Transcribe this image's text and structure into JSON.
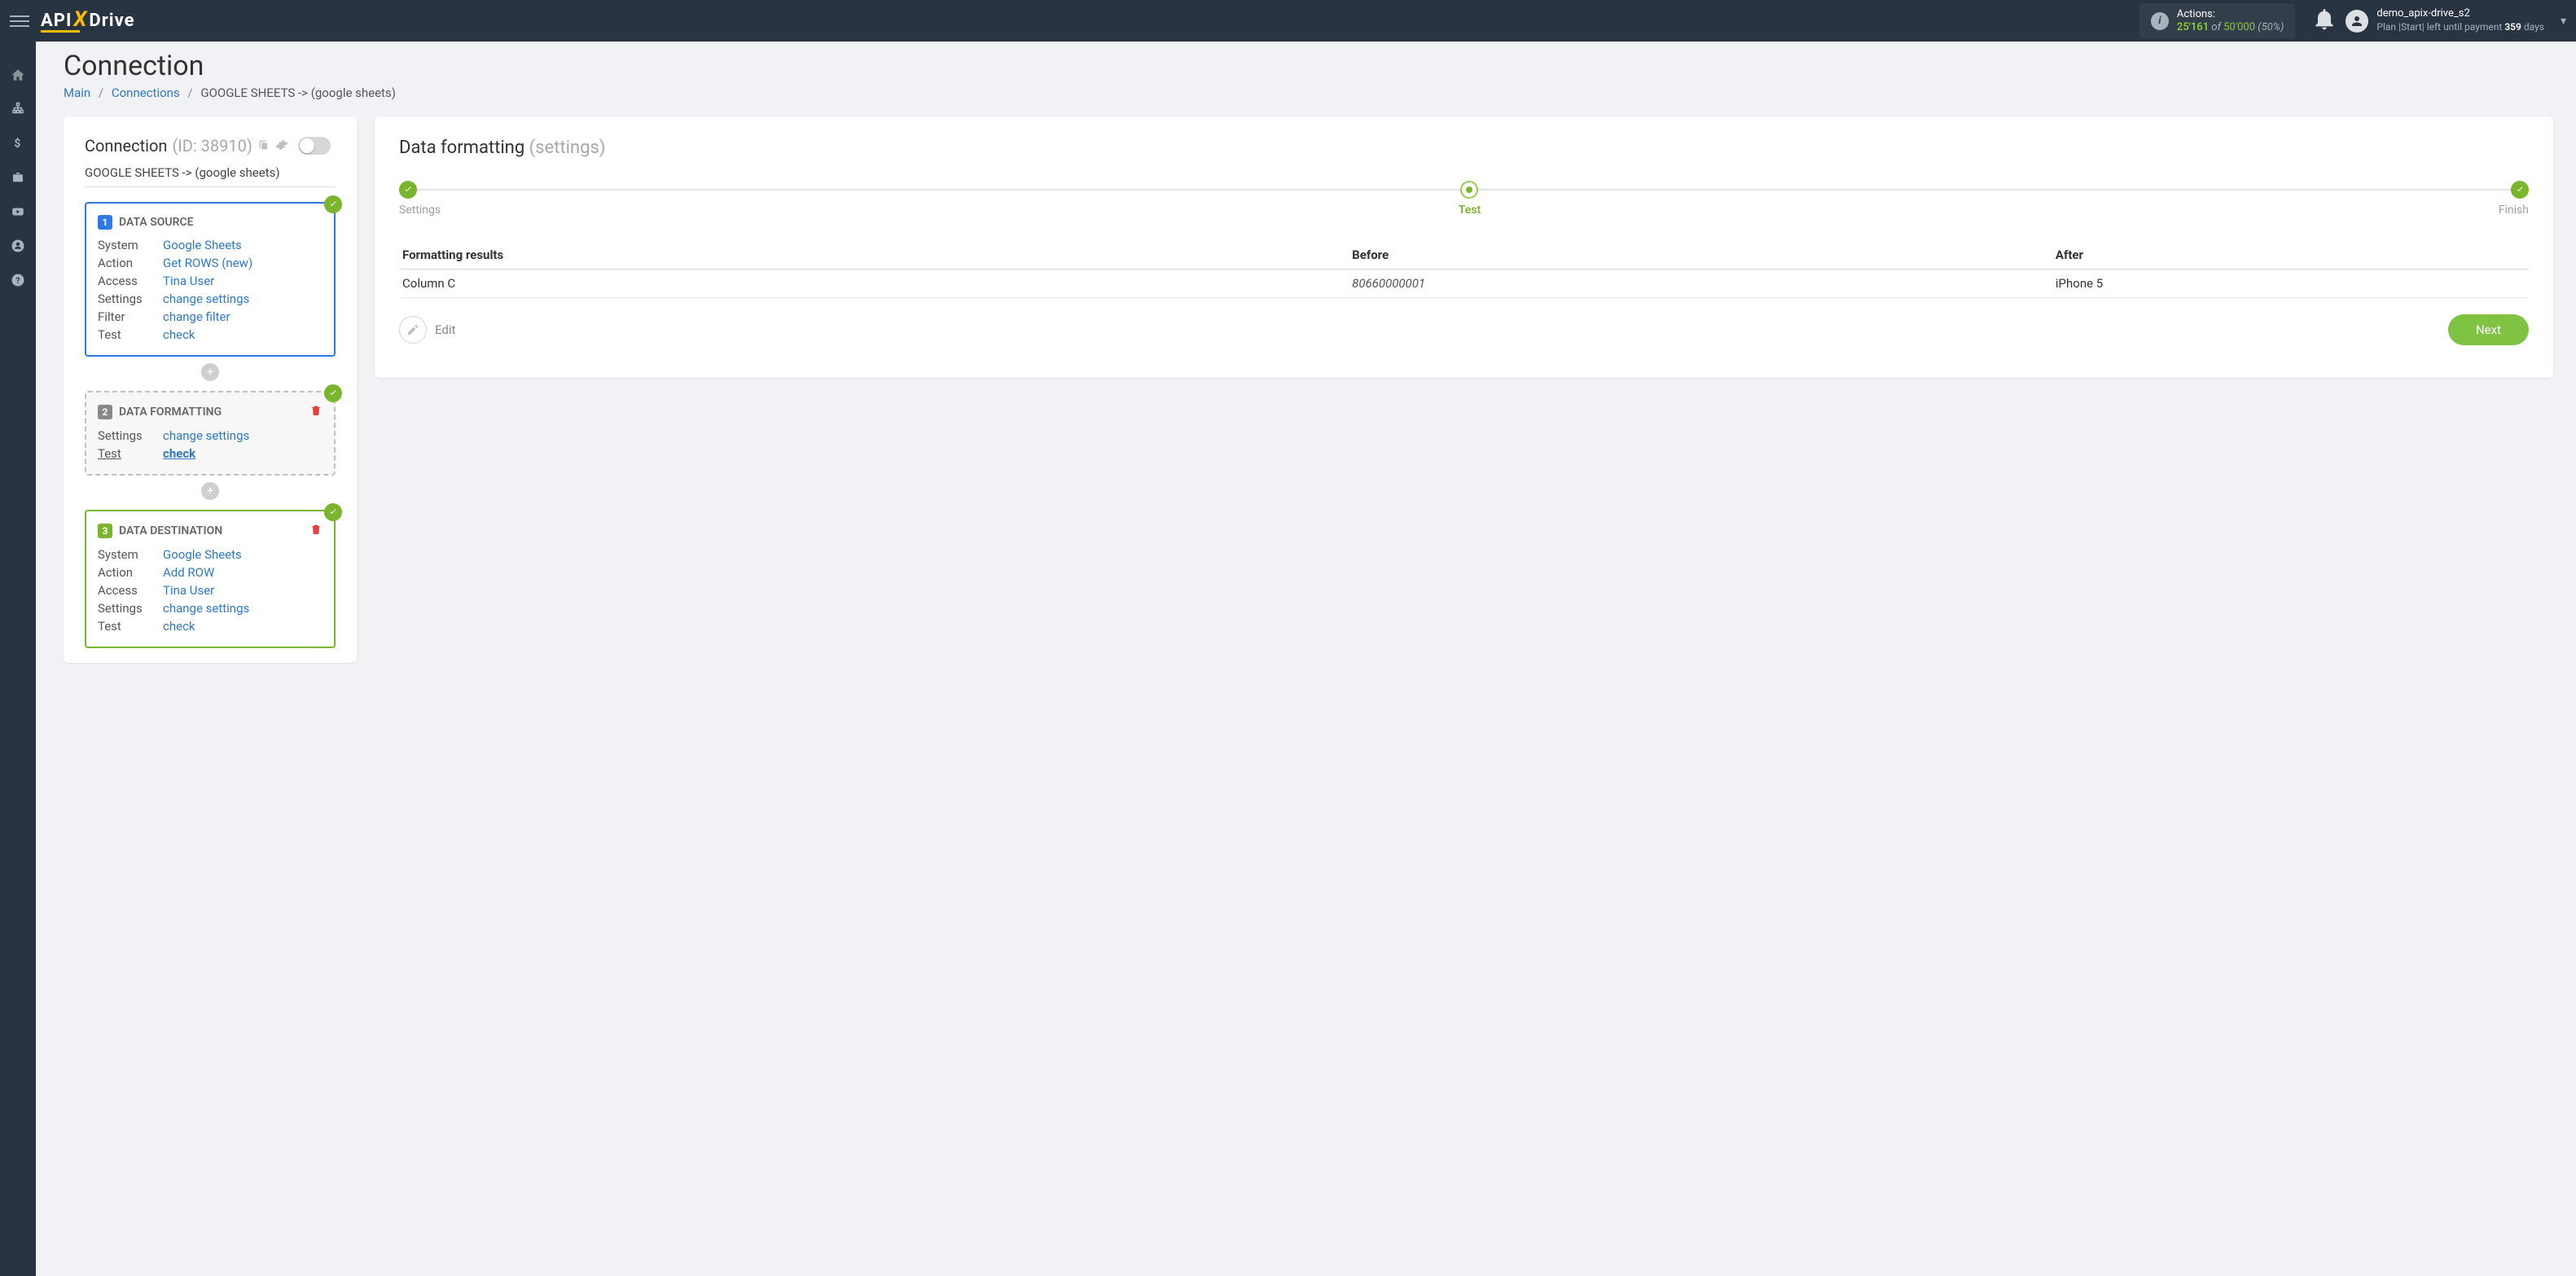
{
  "logo": {
    "api": "API",
    "drive": "Drive"
  },
  "header": {
    "actions_label": "Actions:",
    "used": "25'161",
    "of": "of",
    "limit": "50'000",
    "pct": "(50%)",
    "user": "demo_apix-drive_s2",
    "plan_prefix": "Plan |Start| left until payment ",
    "plan_days": "359",
    "plan_suffix": " days"
  },
  "page_title": "Connection",
  "crumbs": {
    "main": "Main",
    "connections": "Connections",
    "current": "GOOGLE SHEETS -> (google sheets)"
  },
  "conn_panel": {
    "title": "Connection ",
    "id_label": "(ID: 38910)",
    "name": "GOOGLE SHEETS -> (google sheets)",
    "source": {
      "title": "DATA SOURCE",
      "rows": {
        "System": "Google Sheets",
        "Action": "Get ROWS (new)",
        "Access": "Tina User",
        "Settings": "change settings",
        "Filter": "change filter",
        "Test": "check"
      }
    },
    "formatting": {
      "title": "DATA FORMATTING",
      "rows": {
        "Settings": "change settings",
        "Test": "check"
      }
    },
    "destination": {
      "title": "DATA DESTINATION",
      "rows": {
        "System": "Google Sheets",
        "Action": "Add ROW",
        "Access": "Tina User",
        "Settings": "change settings",
        "Test": "check"
      }
    }
  },
  "main": {
    "title": "Data formatting ",
    "subtitle": "(settings)",
    "steps": {
      "settings": "Settings",
      "test": "Test",
      "finish": "Finish"
    },
    "table": {
      "headers": {
        "c1": "Formatting results",
        "c2": "Before",
        "c3": "After"
      },
      "row": {
        "c1": "Column C",
        "c2": "80660000001",
        "c3": "iPhone 5"
      }
    },
    "edit": "Edit",
    "next": "Next"
  }
}
